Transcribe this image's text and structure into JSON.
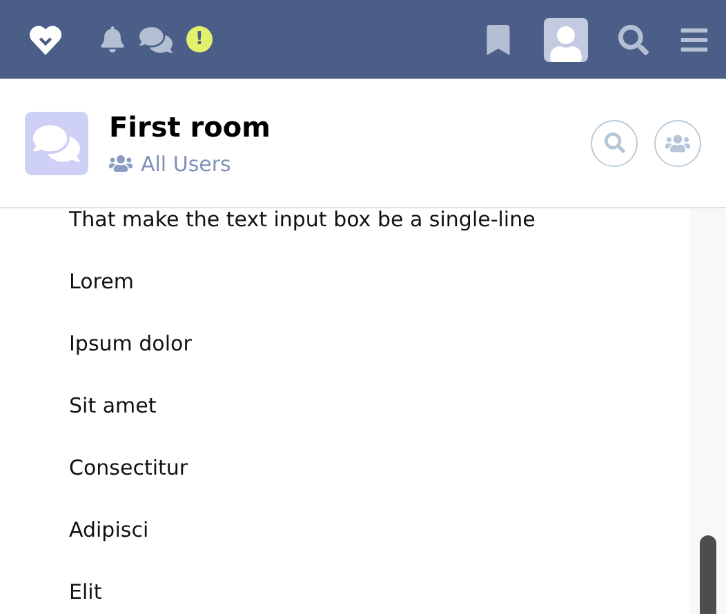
{
  "top_bar": {
    "alert_badge": "!"
  },
  "room": {
    "title": "First room",
    "audience": "All Users"
  },
  "messages": [
    "That make the text input box be a single-line",
    "Lorem",
    "Ipsum dolor",
    "Sit amet",
    "Consectitur",
    "Adipisci",
    "Elit"
  ]
}
